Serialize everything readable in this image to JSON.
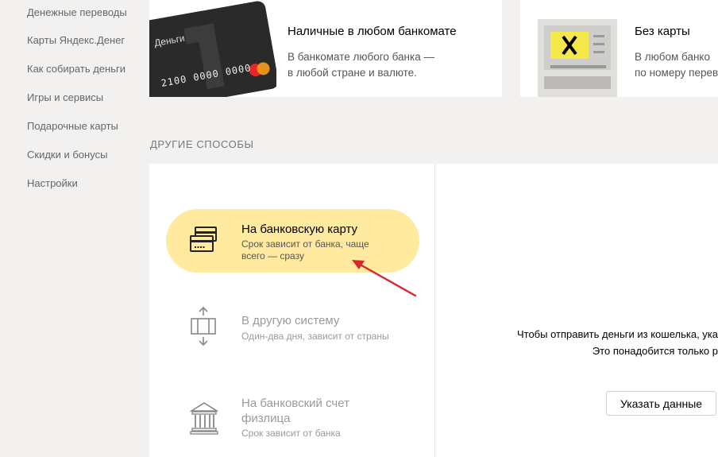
{
  "sidebar": {
    "items": [
      {
        "label": "Денежные переводы"
      },
      {
        "label": "Карты Яндекс.Денег"
      },
      {
        "label": "Как собирать деньги"
      },
      {
        "label": "Игры и сервисы"
      },
      {
        "label": "Подарочные карты"
      },
      {
        "label": "Скидки и бонусы"
      },
      {
        "label": "Настройки"
      }
    ]
  },
  "top_cards": [
    {
      "card_brand": "Деньги",
      "card_number": "2100 0000 0000",
      "title": "Наличные в любом банкомате",
      "desc_line1": "В банкомате любого банка —",
      "desc_line2": "в любой стране и валюте."
    },
    {
      "title": "Без карты",
      "desc_line1": "В любом банко",
      "desc_line2": "по номеру перев"
    }
  ],
  "section": {
    "title": "ДРУГИЕ СПОСОБЫ"
  },
  "options": [
    {
      "title": "На банковскую карту",
      "sub_line1": "Срок зависит от банка, чаще",
      "sub_line2": "всего — сразу",
      "icon": "bank-card-icon"
    },
    {
      "title": "В другую систему",
      "sub_line1": "Один-два дня, зависит от страны",
      "icon": "transfer-system-icon"
    },
    {
      "title_line1": "На банковский счет",
      "title_line2": "физлица",
      "sub_line1": "Срок зависит от банка",
      "icon": "bank-building-icon"
    }
  ],
  "right_panel": {
    "text_line1": "Чтобы отправить деньги из кошелька, ука",
    "text_line2": "Это понадобится только р",
    "button_label": "Указать данные"
  },
  "colors": {
    "active_option": "#ffeaa0",
    "arrow": "#d9262b",
    "atm_screen": "#f5e84a"
  }
}
